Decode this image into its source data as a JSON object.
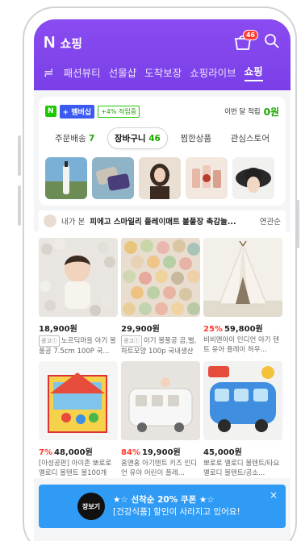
{
  "header": {
    "brand_letter": "N",
    "title": "쇼핑",
    "cart_badge": "46"
  },
  "tabs": {
    "menu_icon": "≓",
    "items": [
      "패션뷰티",
      "선물샵",
      "도착보장",
      "쇼핑라이브",
      "쇼핑"
    ],
    "active_index": 4
  },
  "membership": {
    "n_label": "N",
    "plus_label": "+ 멤버십",
    "rate_label": "+4% 적립중",
    "month_label": "이번 달 적립",
    "month_value": "0원"
  },
  "segments": [
    {
      "label": "주문배송",
      "count": "7"
    },
    {
      "label": "장바구니",
      "count": "46"
    },
    {
      "label": "찜한상품",
      "count": ""
    },
    {
      "label": "관심스토어",
      "count": ""
    }
  ],
  "related": {
    "label": "내가 본",
    "title": "피에고 스마일리 플레이매트 볼풀장 촉감놀...",
    "sort": "연관순"
  },
  "products": [
    {
      "discount": "",
      "price": "18,900원",
      "ad": "광고ⓘ",
      "desc": "노르딕마을 아기 볼풀공 7.5cm 100P 국..."
    },
    {
      "discount": "",
      "price": "29,900원",
      "ad": "광고ⓘ",
      "desc": "이기 볼풀공 곰,별,하트모양 100p 국내생산"
    },
    {
      "discount": "25%",
      "price": "59,800원",
      "ad": "",
      "desc": "비비앤아이 인디언 아기 텐트 유아 플레이 하우..."
    },
    {
      "discount": "7%",
      "price": "48,000원",
      "ad": "",
      "desc": "[아성공판] 아이존 뽀로로 멜로디 볼텐트 볼100개"
    },
    {
      "discount": "84%",
      "price": "19,900원",
      "ad": "",
      "desc": "홈앤홈 아기텐트 키즈 인디언 유아 어린이 플레..."
    },
    {
      "discount": "",
      "price": "45,000원",
      "ad": "",
      "desc": "뽀로로 멜로디 볼텐트/타요 멜로디 볼텐트/공소..."
    }
  ],
  "coupon": {
    "logo": "장보기",
    "line1": "★☆ 선착순 20% 쿠폰 ★☆",
    "line2": "[건강식품] 할인이 사라지고 있어요!",
    "close": "×"
  },
  "colors": {
    "header": "#8a4cf0",
    "naver_green": "#1ec800",
    "discount_red": "#ff3b30",
    "coupon_blue": "#2f9bf5"
  }
}
